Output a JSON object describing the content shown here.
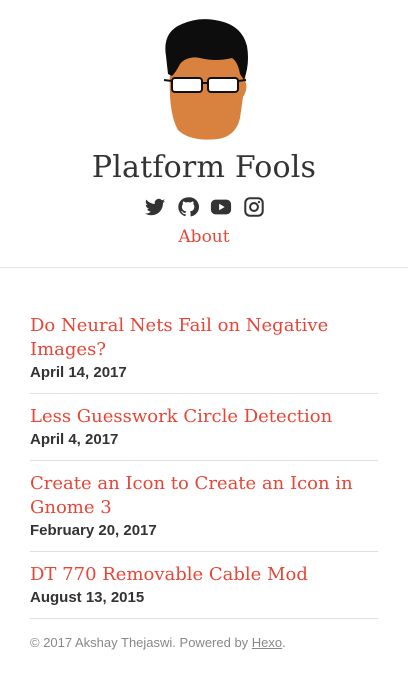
{
  "site": {
    "title": "Platform Fools",
    "avatar_icon": "avatar-portrait-icon",
    "accent_color": "#e84536"
  },
  "social": [
    {
      "icon": "twitter-icon"
    },
    {
      "icon": "github-icon"
    },
    {
      "icon": "youtube-icon"
    },
    {
      "icon": "instagram-icon"
    }
  ],
  "nav": {
    "about_label": "About"
  },
  "posts": [
    {
      "title": "Do Neural Nets Fail on Negative Images?",
      "date": "April 14, 2017"
    },
    {
      "title": "Less Guesswork Circle Detection",
      "date": "April 4, 2017"
    },
    {
      "title": "Create an Icon to Create an Icon in Gnome 3",
      "date": "February 20, 2017"
    },
    {
      "title": "DT 770 Removable Cable Mod",
      "date": "August 13, 2015"
    }
  ],
  "footer": {
    "copyright": "© 2017 Akshay Thejaswi. Powered by ",
    "powered_link": "Hexo",
    "end": "."
  }
}
